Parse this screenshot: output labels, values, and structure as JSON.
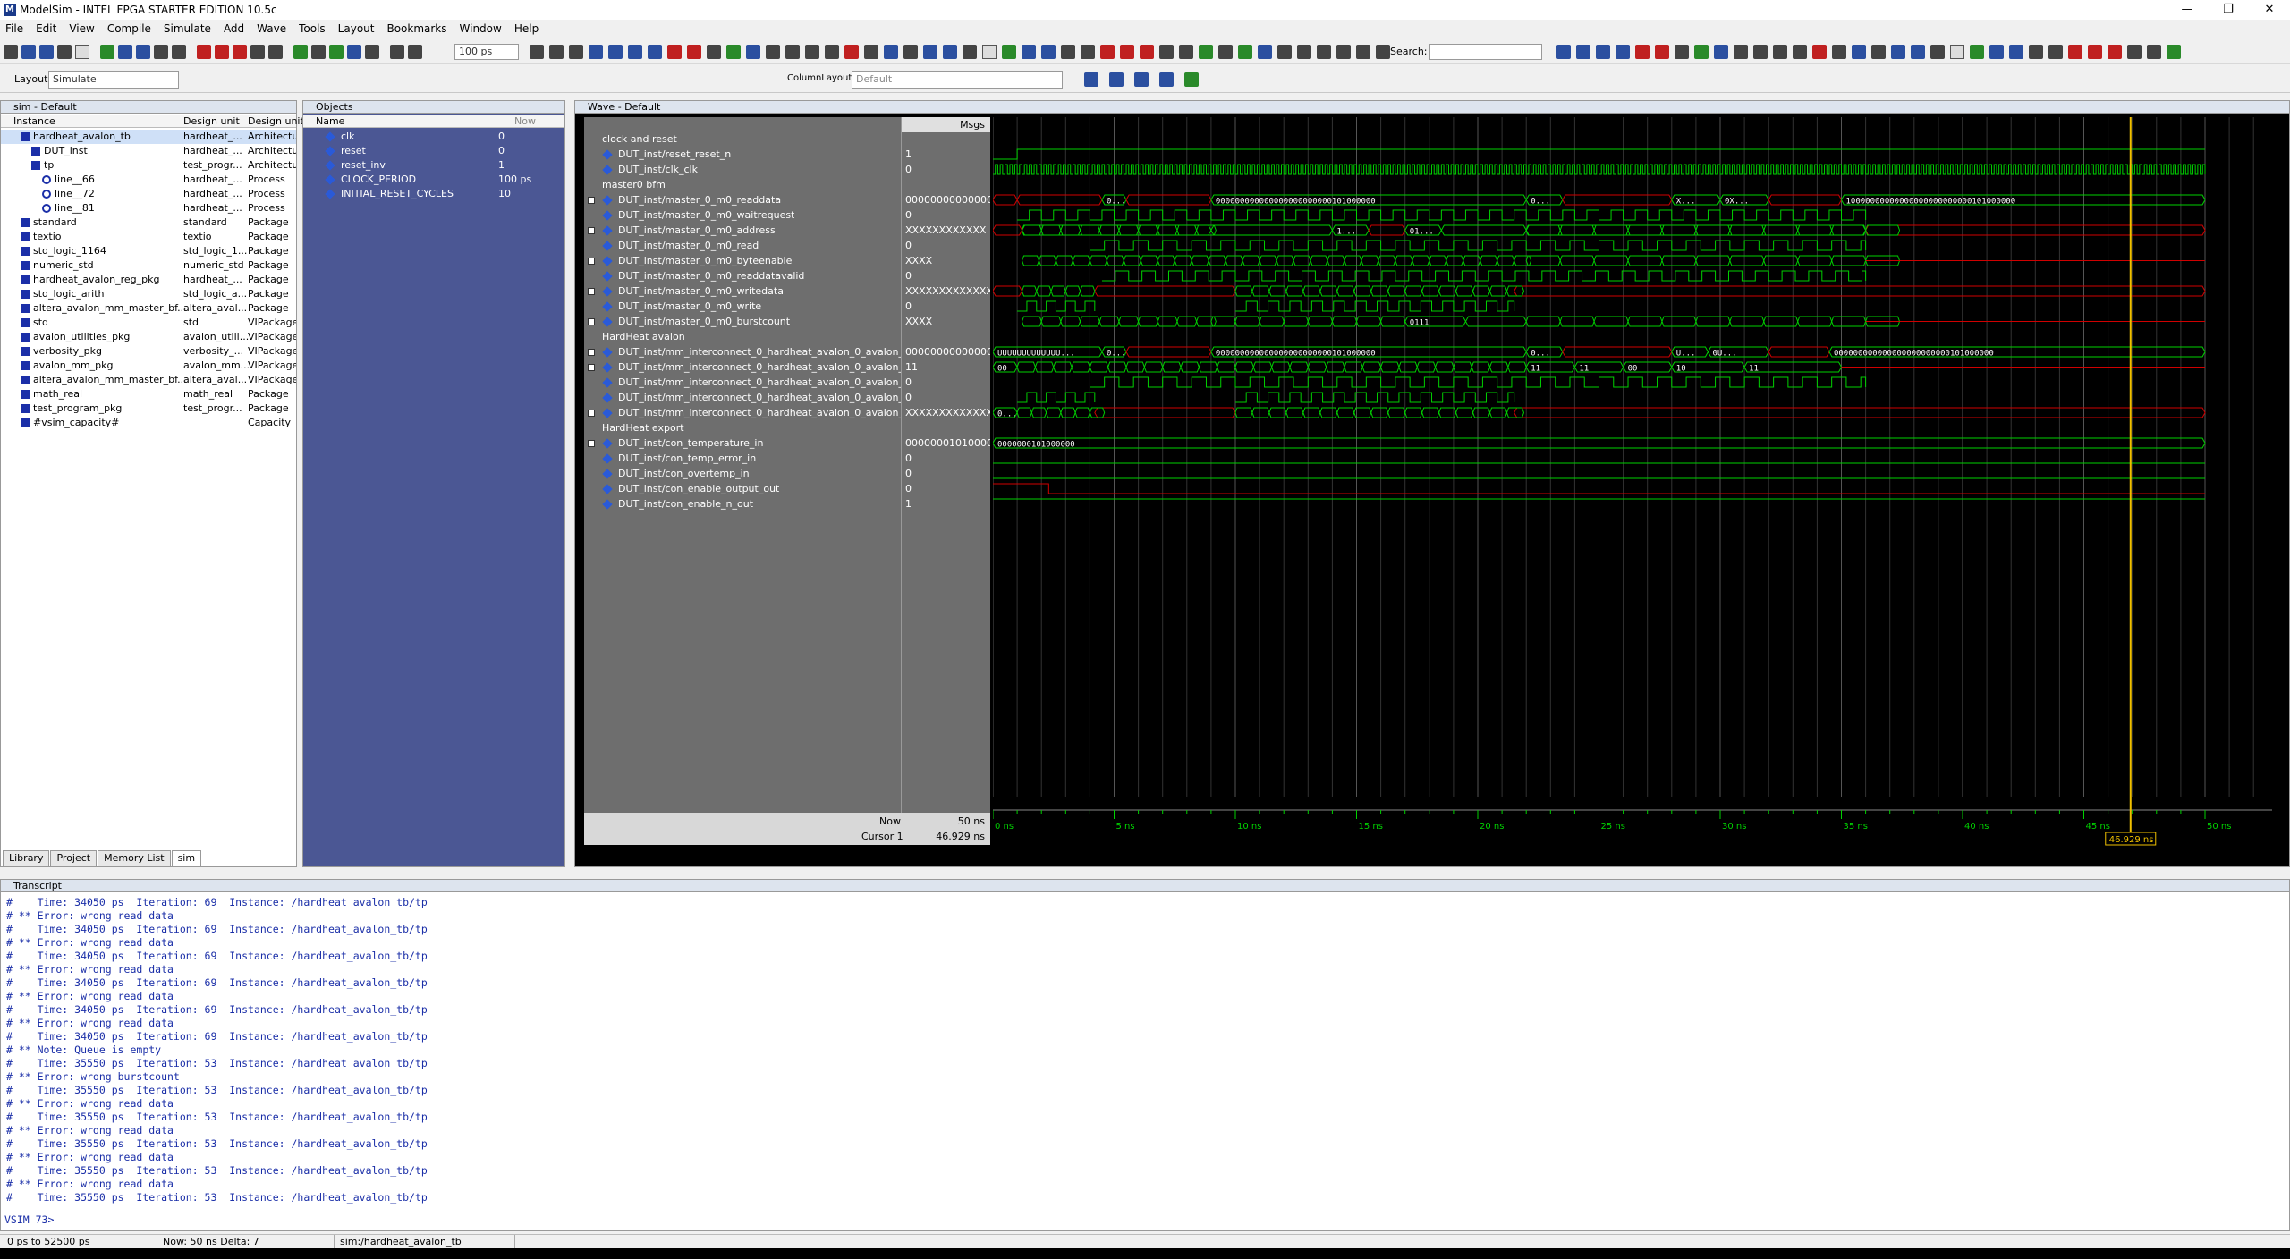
{
  "window": {
    "title": "ModelSim - INTEL FPGA STARTER EDITION 10.5c",
    "minimize": "—",
    "restore": "❐",
    "close": "✕"
  },
  "menu": [
    "File",
    "Edit",
    "View",
    "Compile",
    "Simulate",
    "Add",
    "Wave",
    "Tools",
    "Layout",
    "Bookmarks",
    "Window",
    "Help"
  ],
  "toolbar": {
    "run_length": "100 ps",
    "search_label": "Search:",
    "search_value": ""
  },
  "layout_bar": {
    "layout_label": "Layout",
    "layout_value": "Simulate",
    "column_layout_label": "ColumnLayout",
    "column_layout_value": "Default"
  },
  "sim_panel": {
    "title": "sim - Default",
    "columns": [
      "Instance",
      "Design unit",
      "Design unit"
    ],
    "rows": [
      {
        "name": "hardheat_avalon_tb",
        "unit": "hardheat_...",
        "type": "Architectur"
      },
      {
        "name": "DUT_inst",
        "unit": "hardheat_...",
        "type": "Architectur"
      },
      {
        "name": "tp",
        "unit": "test_progr...",
        "type": "Architectur"
      },
      {
        "name": "line__66",
        "unit": "hardheat_...",
        "type": "Process"
      },
      {
        "name": "line__72",
        "unit": "hardheat_...",
        "type": "Process"
      },
      {
        "name": "line__81",
        "unit": "hardheat_...",
        "type": "Process"
      },
      {
        "name": "standard",
        "unit": "standard",
        "type": "Package"
      },
      {
        "name": "textio",
        "unit": "textio",
        "type": "Package"
      },
      {
        "name": "std_logic_1164",
        "unit": "std_logic_1...",
        "type": "Package"
      },
      {
        "name": "numeric_std",
        "unit": "numeric_std",
        "type": "Package"
      },
      {
        "name": "hardheat_avalon_reg_pkg",
        "unit": "hardheat_...",
        "type": "Package"
      },
      {
        "name": "std_logic_arith",
        "unit": "std_logic_a...",
        "type": "Package"
      },
      {
        "name": "altera_avalon_mm_master_bf...",
        "unit": "altera_aval...",
        "type": "Package"
      },
      {
        "name": "std",
        "unit": "std",
        "type": "VIPackage"
      },
      {
        "name": "avalon_utilities_pkg",
        "unit": "avalon_utili...",
        "type": "VIPackage"
      },
      {
        "name": "verbosity_pkg",
        "unit": "verbosity_...",
        "type": "VIPackage"
      },
      {
        "name": "avalon_mm_pkg",
        "unit": "avalon_mm...",
        "type": "VIPackage"
      },
      {
        "name": "altera_avalon_mm_master_bf...",
        "unit": "altera_aval...",
        "type": "VIPackage"
      },
      {
        "name": "math_real",
        "unit": "math_real",
        "type": "Package"
      },
      {
        "name": "test_program_pkg",
        "unit": "test_progr...",
        "type": "Package"
      },
      {
        "name": "#vsim_capacity#",
        "unit": "",
        "type": "Capacity"
      }
    ],
    "tabs": [
      "Library",
      "Project",
      "Memory List",
      "sim"
    ]
  },
  "objects_panel": {
    "title": "Objects",
    "columns": [
      "Name",
      "Now"
    ],
    "rows": [
      {
        "name": "clk",
        "value": "0"
      },
      {
        "name": "reset",
        "value": "0"
      },
      {
        "name": "reset_inv",
        "value": "1"
      },
      {
        "name": "CLOCK_PERIOD",
        "value": "100 ps"
      },
      {
        "name": "INITIAL_RESET_CYCLES",
        "value": "10"
      }
    ]
  },
  "wave_panel": {
    "title": "Wave - Default",
    "msgs_header": "Msgs",
    "rows": [
      {
        "kind": "group",
        "name": "clock and reset",
        "value": ""
      },
      {
        "kind": "sig",
        "name": "DUT_inst/reset_reset_n",
        "value": "1"
      },
      {
        "kind": "sig",
        "name": "DUT_inst/clk_clk",
        "value": "0"
      },
      {
        "kind": "group",
        "name": "master0 bfm",
        "value": ""
      },
      {
        "kind": "bus",
        "name": "DUT_inst/master_0_m0_readdata",
        "value": "000000000000000..."
      },
      {
        "kind": "sig",
        "name": "DUT_inst/master_0_m0_waitrequest",
        "value": "0"
      },
      {
        "kind": "bus",
        "name": "DUT_inst/master_0_m0_address",
        "value": "XXXXXXXXXXXX"
      },
      {
        "kind": "sig",
        "name": "DUT_inst/master_0_m0_read",
        "value": "0"
      },
      {
        "kind": "bus",
        "name": "DUT_inst/master_0_m0_byteenable",
        "value": "XXXX"
      },
      {
        "kind": "sig",
        "name": "DUT_inst/master_0_m0_readdatavalid",
        "value": "0"
      },
      {
        "kind": "bus",
        "name": "DUT_inst/master_0_m0_writedata",
        "value": "XXXXXXXXXXXXXX..."
      },
      {
        "kind": "sig",
        "name": "DUT_inst/master_0_m0_write",
        "value": "0"
      },
      {
        "kind": "bus",
        "name": "DUT_inst/master_0_m0_burstcount",
        "value": "XXXX"
      },
      {
        "kind": "group",
        "name": "HardHeat avalon",
        "value": ""
      },
      {
        "kind": "bus",
        "name": "DUT_inst/mm_interconnect_0_hardheat_avalon_0_avalon_sla...",
        "value": "000000000000000..."
      },
      {
        "kind": "bus",
        "name": "DUT_inst/mm_interconnect_0_hardheat_avalon_0_avalon_sla...",
        "value": "11"
      },
      {
        "kind": "sig",
        "name": "DUT_inst/mm_interconnect_0_hardheat_avalon_0_avalon_sla...",
        "value": "0"
      },
      {
        "kind": "sig",
        "name": "DUT_inst/mm_interconnect_0_hardheat_avalon_0_avalon_sla...",
        "value": "0"
      },
      {
        "kind": "bus",
        "name": "DUT_inst/mm_interconnect_0_hardheat_avalon_0_avalon_sla...",
        "value": "XXXXXXXXXXXXXX..."
      },
      {
        "kind": "group",
        "name": "HardHeat export",
        "value": ""
      },
      {
        "kind": "bus",
        "name": "DUT_inst/con_temperature_in",
        "value": "0000000101000000"
      },
      {
        "kind": "sig",
        "name": "DUT_inst/con_temp_error_in",
        "value": "0"
      },
      {
        "kind": "sig",
        "name": "DUT_inst/con_overtemp_in",
        "value": "0"
      },
      {
        "kind": "sig",
        "name": "DUT_inst/con_enable_output_out",
        "value": "0"
      },
      {
        "kind": "sig",
        "name": "DUT_inst/con_enable_n_out",
        "value": "1"
      }
    ],
    "bus_labels": {
      "readdata_a": "0...",
      "readdata_b": "000000000000000000000000101000000",
      "readdata_c": "0...",
      "readdata_d": "X...",
      "readdata_e": "0X...",
      "readdata_f": "10000000000000000000000000101000000",
      "address_a": "1...",
      "address_b": "01...",
      "burstcount_a": "0111",
      "slv_readdata_a": "UUUUUUUUUUUUU...",
      "slv_readdata_b": "000000000000000000000000101000000",
      "slv_readdata_c": "U...",
      "slv_readdata_d": "0U...",
      "slv_readdata_e": "0...",
      "slv_readdata_f": "000000000000000000000000101000000",
      "slv_addr_a": "00",
      "slv_addr_b": "10",
      "slv_addr_c": "11",
      "slv_addr_d": "00",
      "slv_addr_e": "11",
      "slv_wd_a": "0...",
      "temp": "0000000101000000"
    },
    "now_label": "Now",
    "now_value": "50 ns",
    "cursor_label": "Cursor 1",
    "cursor_value": "46.929 ns",
    "cursor_tag": "46.929 ns",
    "time_ticks": [
      "0 ns",
      "5 ns",
      "10 ns",
      "15 ns",
      "20 ns",
      "25 ns",
      "30 ns",
      "35 ns",
      "40 ns",
      "45 ns",
      "50 ns"
    ]
  },
  "transcript": {
    "title": "Transcript",
    "lines": [
      "#    Time: 34050 ps  Iteration: 69  Instance: /hardheat_avalon_tb/tp",
      "# ** Error: wrong read data",
      "#    Time: 34050 ps  Iteration: 69  Instance: /hardheat_avalon_tb/tp",
      "# ** Error: wrong read data",
      "#    Time: 34050 ps  Iteration: 69  Instance: /hardheat_avalon_tb/tp",
      "# ** Error: wrong read data",
      "#    Time: 34050 ps  Iteration: 69  Instance: /hardheat_avalon_tb/tp",
      "# ** Error: wrong read data",
      "#    Time: 34050 ps  Iteration: 69  Instance: /hardheat_avalon_tb/tp",
      "# ** Error: wrong read data",
      "#    Time: 34050 ps  Iteration: 69  Instance: /hardheat_avalon_tb/tp",
      "# ** Note: Queue is empty",
      "#    Time: 35550 ps  Iteration: 53  Instance: /hardheat_avalon_tb/tp",
      "# ** Error: wrong burstcount",
      "#    Time: 35550 ps  Iteration: 53  Instance: /hardheat_avalon_tb/tp",
      "# ** Error: wrong read data",
      "#    Time: 35550 ps  Iteration: 53  Instance: /hardheat_avalon_tb/tp",
      "# ** Error: wrong read data",
      "#    Time: 35550 ps  Iteration: 53  Instance: /hardheat_avalon_tb/tp",
      "# ** Error: wrong read data",
      "#    Time: 35550 ps  Iteration: 53  Instance: /hardheat_avalon_tb/tp",
      "# ** Error: wrong read data",
      "#    Time: 35550 ps  Iteration: 53  Instance: /hardheat_avalon_tb/tp"
    ],
    "prompt": "VSIM 73>"
  },
  "status": {
    "range": "0 ps to 52500 ps",
    "now": "Now: 50 ns  Delta: 7",
    "context": "sim:/hardheat_avalon_tb"
  }
}
